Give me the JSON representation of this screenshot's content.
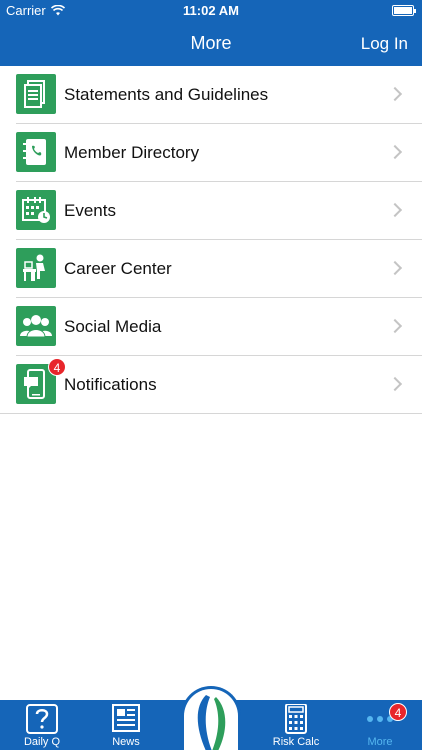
{
  "status_bar": {
    "carrier": "Carrier",
    "time": "11:02 AM"
  },
  "nav": {
    "title": "More",
    "login": "Log In"
  },
  "menu": {
    "items": [
      {
        "label": "Statements and Guidelines",
        "icon": "document-icon"
      },
      {
        "label": "Member Directory",
        "icon": "address-book-icon"
      },
      {
        "label": "Events",
        "icon": "calendar-icon"
      },
      {
        "label": "Career Center",
        "icon": "person-at-desk-icon"
      },
      {
        "label": "Social Media",
        "icon": "group-icon"
      },
      {
        "label": "Notifications",
        "icon": "phone-message-icon",
        "badge": "4"
      }
    ]
  },
  "tabs": [
    {
      "label": "Daily Q",
      "icon": "question-icon"
    },
    {
      "label": "News",
      "icon": "newspaper-icon"
    },
    {
      "label": "Risk Calc",
      "icon": "calculator-icon"
    },
    {
      "label": "More",
      "icon": "more-dots-icon",
      "badge": "4",
      "active": true
    }
  ],
  "colors": {
    "brand_blue": "#1565b8",
    "icon_green": "#2e9e5b",
    "badge_red": "#e8262b",
    "active_tab": "#55b6f0"
  }
}
